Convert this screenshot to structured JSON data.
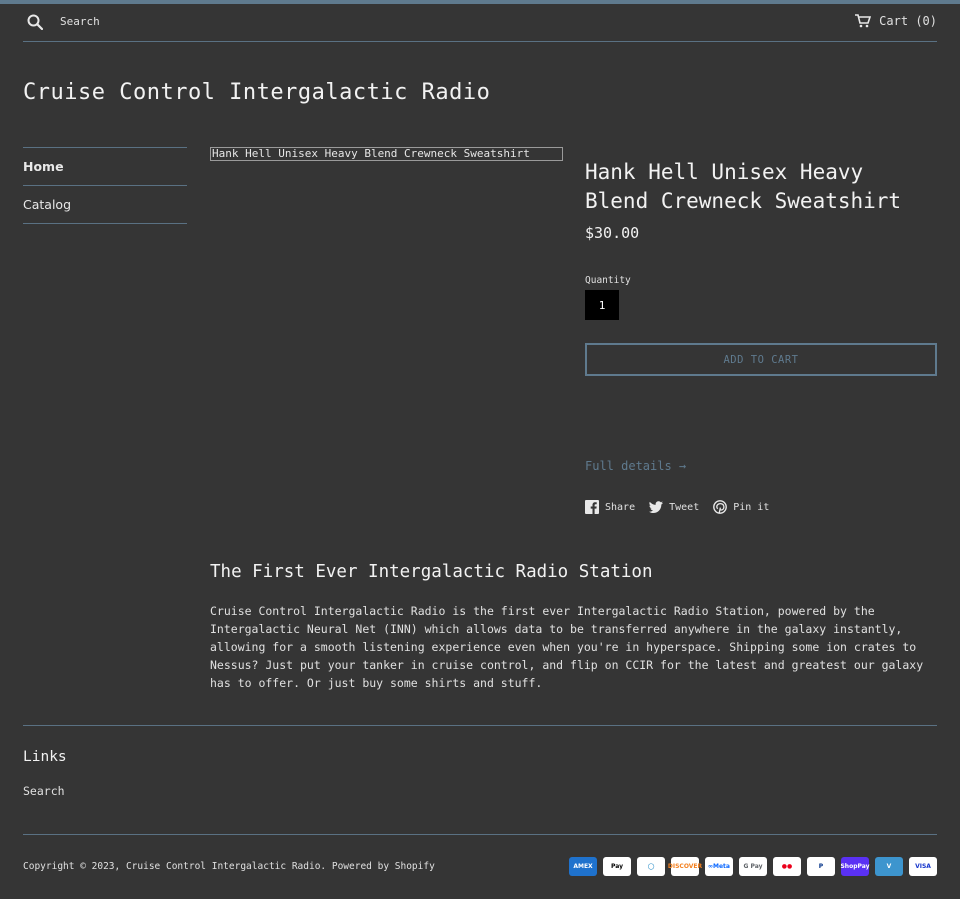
{
  "header": {
    "search_label": "Search",
    "cart_label": "Cart",
    "cart_count": "(0)"
  },
  "site": {
    "title": "Cruise Control Intergalactic Radio"
  },
  "sidebar": {
    "items": [
      {
        "label": "Home",
        "active": true
      },
      {
        "label": "Catalog",
        "active": false
      }
    ]
  },
  "product": {
    "image_alt": "Hank Hell Unisex Heavy Blend Crewneck Sweatshirt",
    "title": "Hank Hell Unisex Heavy Blend Crewneck Sweatshirt",
    "price": "$30.00",
    "quantity_label": "Quantity",
    "quantity_value": "1",
    "add_to_cart": "ADD TO CART",
    "full_details": "Full details →",
    "share": {
      "facebook": "Share",
      "twitter": "Tweet",
      "pinterest": "Pin it"
    }
  },
  "description": {
    "title": "The First Ever Intergalactic Radio Station",
    "body": "Cruise Control Intergalactic Radio is the first ever Intergalactic Radio Station, powered by the Intergalactic Neural Net (INN) which allows data to be transferred anywhere in the galaxy instantly, allowing for a smooth listening experience even when you're in hyperspace. Shipping some ion crates to Nessus? Just put your tanker in cruise control, and flip on CCIR for the latest and greatest our galaxy has to offer. Or just buy some shirts and stuff."
  },
  "footer": {
    "links_title": "Links",
    "links": [
      {
        "label": "Search"
      }
    ],
    "copyright": "Copyright © 2023, Cruise Control Intergalactic Radio. Powered by Shopify",
    "payment_methods": [
      {
        "name": "amex-icon",
        "label": "AMEX",
        "bg": "#1f72cd",
        "fg": "#ffffff"
      },
      {
        "name": "apple-pay-icon",
        "label": " Pay",
        "bg": "#ffffff",
        "fg": "#000000"
      },
      {
        "name": "diners-club-icon",
        "label": "◯",
        "bg": "#ffffff",
        "fg": "#0079be"
      },
      {
        "name": "discover-icon",
        "label": "DISCOVER",
        "bg": "#ffffff",
        "fg": "#f48120"
      },
      {
        "name": "meta-pay-icon",
        "label": "∞Meta",
        "bg": "#ffffff",
        "fg": "#0866ff"
      },
      {
        "name": "google-pay-icon",
        "label": "G Pay",
        "bg": "#ffffff",
        "fg": "#5f6368"
      },
      {
        "name": "mastercard-icon",
        "label": "●●",
        "bg": "#ffffff",
        "fg": "#eb001b"
      },
      {
        "name": "paypal-icon",
        "label": "P",
        "bg": "#ffffff",
        "fg": "#003087"
      },
      {
        "name": "shop-pay-icon",
        "label": "ShopPay",
        "bg": "#5a31f4",
        "fg": "#ffffff"
      },
      {
        "name": "venmo-icon",
        "label": "V",
        "bg": "#3d95ce",
        "fg": "#ffffff"
      },
      {
        "name": "visa-icon",
        "label": "VISA",
        "bg": "#ffffff",
        "fg": "#1434cb"
      }
    ]
  },
  "colors": {
    "background": "#353535",
    "accent": "#5f7a8e",
    "divider": "#5a7183"
  }
}
